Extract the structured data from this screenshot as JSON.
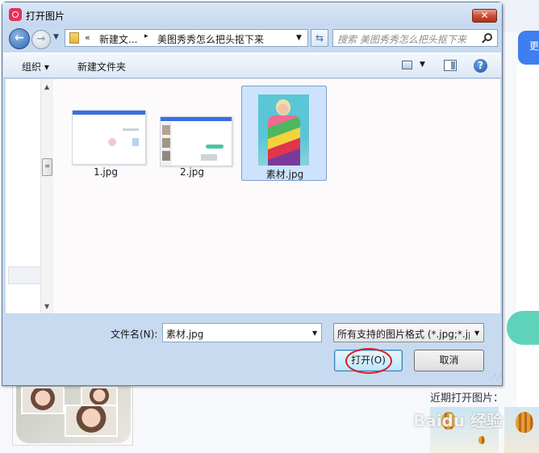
{
  "background_app": {
    "tab_label": "更",
    "recent_label": "近期打开图片："
  },
  "dialog": {
    "title": "打开图片",
    "close_label": "✕",
    "address": {
      "chevron": "«",
      "segments": [
        "新建文...",
        "美图秀秀怎么把头抠下来"
      ],
      "separator": "▸"
    },
    "search_placeholder": "搜索 美图秀秀怎么把头抠下来",
    "toolbar": {
      "organize_label": "组织 ▾",
      "new_folder_label": "新建文件夹",
      "help_label": "?"
    },
    "files": [
      {
        "name": "1.jpg",
        "selected": false
      },
      {
        "name": "2.jpg",
        "selected": false
      },
      {
        "name": "素材.jpg",
        "selected": true
      }
    ],
    "filename_label": "文件名(N):",
    "filename_value": "素材.jpg",
    "filetype_value": "所有支持的图片格式 (*.jpg;*.jp",
    "open_label": "打开(O)",
    "cancel_label": "取消"
  },
  "colors": {
    "selection": "#cce3fb",
    "highlight_circle": "#d81e1e",
    "accent_blue": "#3d7ef0",
    "accent_teal": "#5fd3ba"
  }
}
